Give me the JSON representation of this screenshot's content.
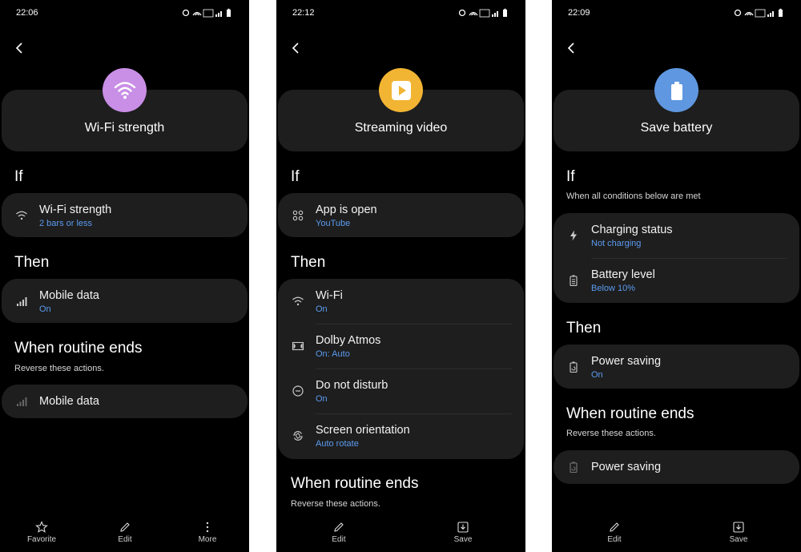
{
  "screens": [
    {
      "time": "22:06",
      "header": {
        "title": "Wi-Fi strength",
        "icon": "wifi-icon",
        "color": "#c98ee6"
      },
      "if": {
        "label": "If",
        "rows": [
          {
            "title": "Wi-Fi strength",
            "sub": "2 bars or less",
            "icon": "wifi-icon"
          }
        ]
      },
      "then": {
        "label": "Then",
        "rows": [
          {
            "title": "Mobile data",
            "sub": "On",
            "icon": "signal-icon"
          }
        ]
      },
      "ends": {
        "label": "When routine ends",
        "sub": "Reverse these actions.",
        "rows": [
          {
            "title": "Mobile data",
            "icon": "signal-dim-icon"
          }
        ]
      },
      "bottom": [
        {
          "label": "Favorite",
          "icon": "star-icon"
        },
        {
          "label": "Edit",
          "icon": "pencil-icon"
        },
        {
          "label": "More",
          "icon": "more-icon"
        }
      ]
    },
    {
      "time": "22:12",
      "header": {
        "title": "Streaming video",
        "icon": "play-icon",
        "color": "#f2b433"
      },
      "if": {
        "label": "If",
        "rows": [
          {
            "title": "App is open",
            "sub": "YouTube",
            "icon": "apps-icon"
          }
        ]
      },
      "then": {
        "label": "Then",
        "rows": [
          {
            "title": "Wi-Fi",
            "sub": "On",
            "icon": "wifi-icon"
          },
          {
            "title": "Dolby Atmos",
            "sub": "On: Auto",
            "icon": "dolby-icon"
          },
          {
            "title": "Do not disturb",
            "sub": "On",
            "icon": "dnd-icon"
          },
          {
            "title": "Screen orientation",
            "sub": "Auto rotate",
            "icon": "rotate-icon"
          }
        ]
      },
      "ends": {
        "label": "When routine ends",
        "sub": "Reverse these actions."
      },
      "bottom": [
        {
          "label": "Edit",
          "icon": "pencil-icon"
        },
        {
          "label": "Save",
          "icon": "save-icon"
        }
      ]
    },
    {
      "time": "22:09",
      "header": {
        "title": "Save battery",
        "icon": "battery-icon",
        "color": "#5f97e0"
      },
      "if": {
        "label": "If",
        "sub": "When all conditions below are met",
        "rows": [
          {
            "title": "Charging status",
            "sub": "Not charging",
            "icon": "bolt-icon"
          },
          {
            "title": "Battery level",
            "sub": "Below 10%",
            "icon": "battery-small-icon"
          }
        ]
      },
      "then": {
        "label": "Then",
        "rows": [
          {
            "title": "Power saving",
            "sub": "On",
            "icon": "power-saving-icon"
          }
        ]
      },
      "ends": {
        "label": "When routine ends",
        "sub": "Reverse these actions.",
        "rows": [
          {
            "title": "Power saving",
            "icon": "power-saving-dim-icon"
          }
        ]
      },
      "bottom": [
        {
          "label": "Edit",
          "icon": "pencil-icon"
        },
        {
          "label": "Save",
          "icon": "save-icon"
        }
      ]
    }
  ]
}
